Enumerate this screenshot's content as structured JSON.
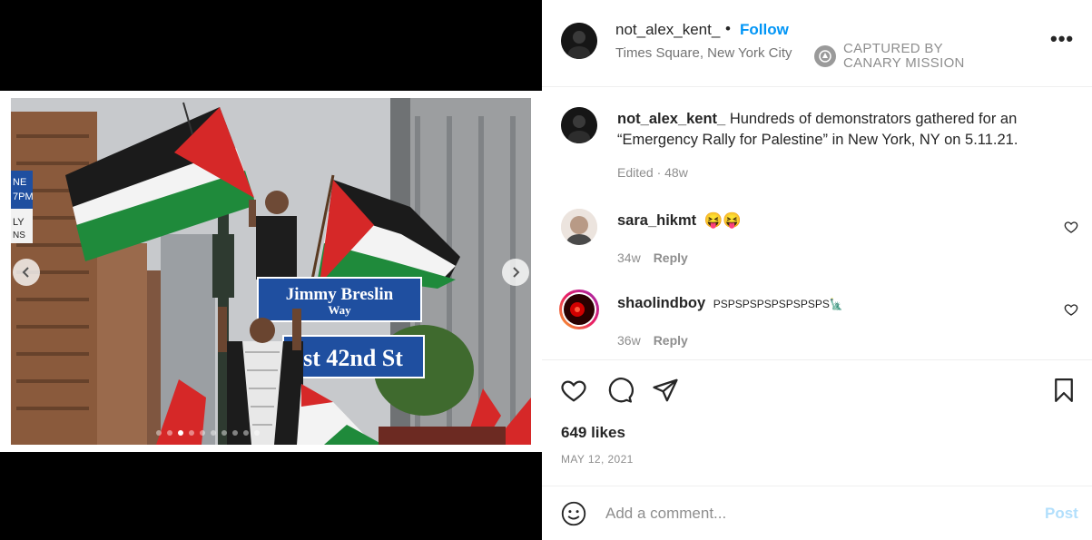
{
  "post": {
    "author": "not_alex_kent_",
    "separator": "•",
    "follow_label": "Follow",
    "location": "Times Square, New York City",
    "more_label": "•••",
    "watermark_line1": "CAPTURED BY",
    "watermark_line2": "CANARY MISSION"
  },
  "caption": {
    "user": "not_alex_kent_",
    "text": " Hundreds of demonstrators gathered for an “Emergency Rally for Palestine” in New York, NY on 5.11.21.",
    "meta": "Edited · 48w"
  },
  "comments": [
    {
      "user": "sara_hikmt",
      "text": "😝😝",
      "time": "34w",
      "reply_label": "Reply"
    },
    {
      "user": "shaolindboy",
      "text": "PSPSPSPSPSPSPSPS🗽",
      "time": "36w",
      "reply_label": "Reply"
    }
  ],
  "photo": {
    "sign_top_line1": "Jimmy Breslin",
    "sign_top_line2": "Way",
    "sign_bottom": "st 42nd St",
    "left_sign_a": "NE",
    "left_sign_b": "7PM",
    "left_sign_c": "LY",
    "left_sign_d": "NS",
    "carousel_count": 10,
    "carousel_active": 2
  },
  "engagement": {
    "likes": "649 likes",
    "date": "MAY 12, 2021"
  },
  "comment_box": {
    "placeholder": "Add a comment...",
    "post_label": "Post"
  },
  "icons": {
    "like": "heart-icon",
    "comment": "comment-icon",
    "share": "send-icon",
    "save": "bookmark-icon",
    "emoji": "emoji-icon",
    "more": "more-icon",
    "prev": "chevron-left-icon",
    "next": "chevron-right-icon"
  },
  "colors": {
    "link": "#0095f6",
    "post_disabled": "#b2dffc",
    "flag_red": "#d62828",
    "flag_green": "#1f8a3b",
    "sign_blue": "#1f4fa0"
  }
}
